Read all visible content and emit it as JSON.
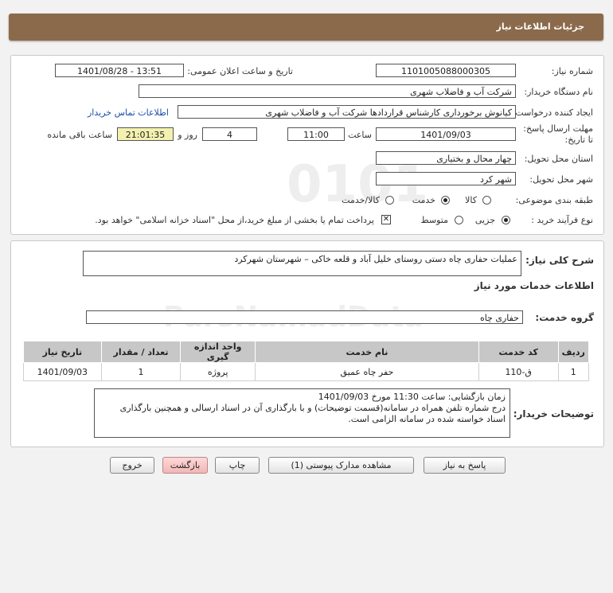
{
  "header": {
    "title": "جزئیات اطلاعات نیاز"
  },
  "info": {
    "need_number_label": "شماره نیاز:",
    "need_number": "1101005088000305",
    "announce_label": "تاریخ و ساعت اعلان عمومی:",
    "announce_value": "1401/08/28 - 13:51",
    "buyer_org_label": "نام دستگاه خریدار:",
    "buyer_org": "شرکت آب و فاضلاب شهری",
    "requester_label": "ایجاد کننده درخواست:",
    "requester": "کیانوش برخورداری کارشناس قراردادها شرکت آب و فاضلاب شهری",
    "contact_link": "اطلاعات تماس خریدار",
    "deadline_label": "مهلت ارسال پاسخ: تا تاریخ:",
    "deadline_date": "1401/09/03",
    "hour_label": "ساعت",
    "deadline_time": "11:00",
    "days_value": "4",
    "days_label": "روز و",
    "remaining_time": "21:01:35",
    "remaining_label": "ساعت باقی مانده",
    "province_label": "استان محل تحویل:",
    "province": "چهار محال و بختیاری",
    "city_label": "شهر محل تحویل:",
    "city": "شهر کرد",
    "category_label": "طبقه بندی موضوعی:",
    "category_options": [
      "کالا",
      "خدمت",
      "کالا/خدمت"
    ],
    "category_selected": 1,
    "process_label": "نوع فرآیند خرید :",
    "process_options": [
      "جزیی",
      "متوسط"
    ],
    "process_selected": 0,
    "payment_text": "پرداخت تمام یا بخشی از مبلغ خرید،از محل \"اسناد خزانه اسلامی\" خواهد بود.",
    "payment_checked": true
  },
  "desc": {
    "summary_label": "شرح کلی نیاز:",
    "summary": "عملیات حفاری چاه دستی روستای خلیل آباد و قلعه خاکی – شهرستان شهرکرد",
    "services_heading": "اطلاعات خدمات مورد نیاز",
    "group_label": "گروه خدمت:",
    "group_value": "حفاری چاه",
    "table": {
      "headers": [
        "ردیف",
        "کد خدمت",
        "نام خدمت",
        "واحد اندازه گیری",
        "تعداد / مقدار",
        "تاریخ نیاز"
      ],
      "rows": [
        [
          "1",
          "ق-110",
          "حفر چاه عمیق",
          "پروژه",
          "1",
          "1401/09/03"
        ]
      ]
    },
    "buyer_notes_label": "توضیحات خریدار:",
    "buyer_notes_line1": "زمان بازگشایی: ساعت 11:30 مورخ 1401/09/03",
    "buyer_notes_line2": "درج شماره تلفن همراه در سامانه(قسمت توضیحات) و با بارگذاری آن در اسناد ارسالی و همچنین بارگذاری اسناد خواسته شده در سامانه الزامی است."
  },
  "buttons": {
    "reply": "پاسخ به نیاز",
    "attachments": "مشاهده مدارک پیوستی (1)",
    "print": "چاپ",
    "back": "بازگشت",
    "exit": "خروج"
  },
  "colors": {
    "header_bg": "#8b6a4b",
    "remaining_bg": "#f4f1b0",
    "link": "#1a4fa8",
    "exit_bg": "#f3b6b6"
  }
}
